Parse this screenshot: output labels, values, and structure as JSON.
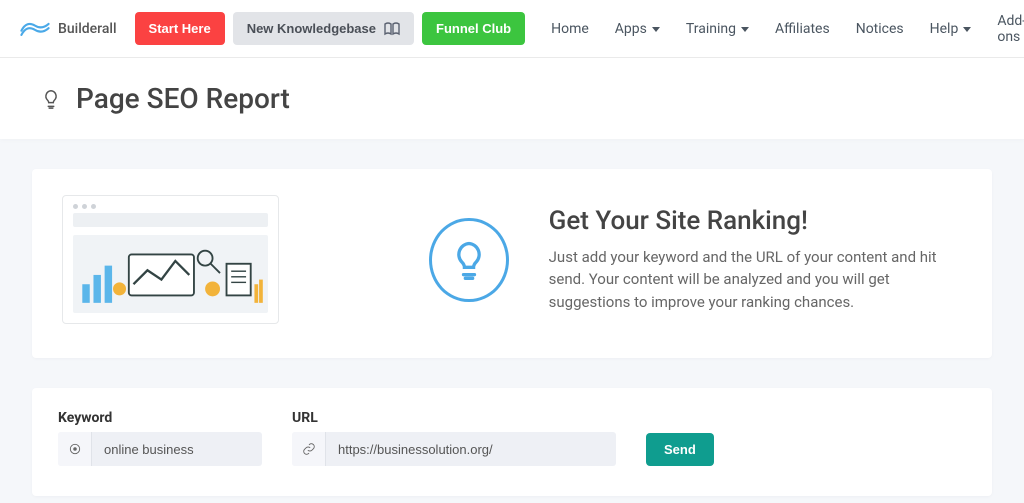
{
  "brand": "Builderall",
  "topButtons": {
    "start": "Start Here",
    "kb": "New Knowledgebase",
    "funnel": "Funnel Club"
  },
  "nav": {
    "home": "Home",
    "apps": "Apps",
    "training": "Training",
    "affiliates": "Affiliates",
    "notices": "Notices",
    "help": "Help",
    "addons": "Add-ons"
  },
  "pageTitle": "Page SEO Report",
  "hero": {
    "title": "Get Your Site Ranking!",
    "desc": "Just add your keyword and the URL of your content and hit send. Your content will be analyzed and you will get suggestions to improve your ranking chances."
  },
  "form": {
    "keywordLabel": "Keyword",
    "keywordValue": "online business",
    "urlLabel": "URL",
    "urlValue": "https://businessolution.org/",
    "send": "Send"
  }
}
